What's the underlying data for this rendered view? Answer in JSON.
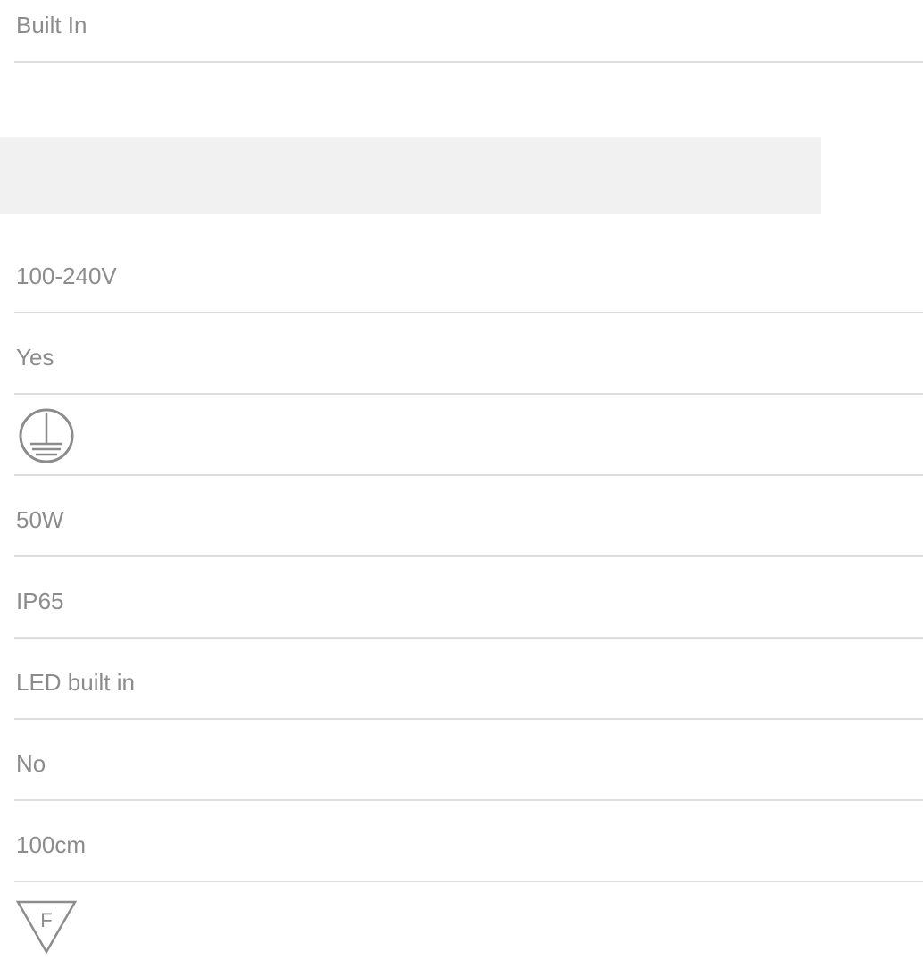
{
  "rows": {
    "mounting": "Built In",
    "voltage": "100-240V",
    "dimmable": "Yes",
    "class_symbol": "earth-ground-icon",
    "wattage": "50W",
    "ip_rating": "IP65",
    "lamp": "LED built in",
    "bulb_included": "No",
    "cable_length": "100cm",
    "f_mark_symbol": "f-mark-triangle-icon",
    "f_mark_letter": "F"
  },
  "colors": {
    "text": "#8c8c8c",
    "divider": "#dedede",
    "band": "#f1f1f1"
  }
}
